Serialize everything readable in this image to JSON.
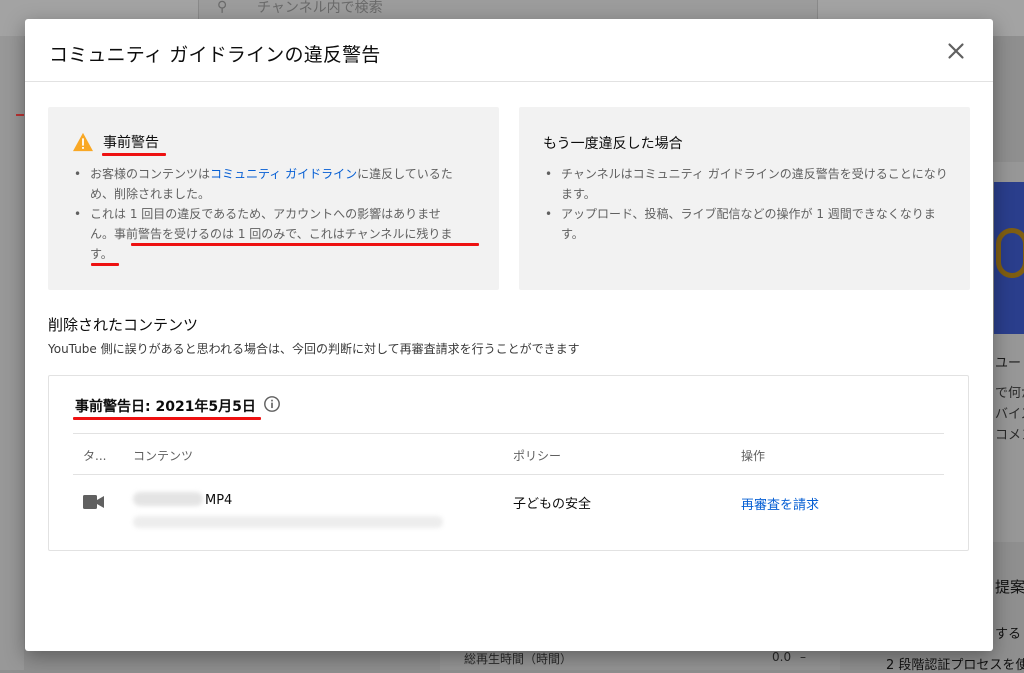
{
  "background": {
    "search_placeholder": "チャンネル内で検索",
    "right_texts": [
      "ユー",
      "で何か",
      "バイス",
      "コメン",
      "提案",
      "する",
      "2 段階認証プロセスを使"
    ],
    "bottom_text": "総再生時間（時間）",
    "bottom_value": "0.0",
    "bottom_dash": "–"
  },
  "dialog": {
    "title": "コミュニティ ガイドラインの違反警告",
    "close_icon": "close-icon"
  },
  "warning_card": {
    "heading": "事前警告",
    "bullet1_pre": "お客様のコンテンツは",
    "bullet1_link": "コミュニティ ガイドライン",
    "bullet1_post": "に違反しているため、削除されました。",
    "bullet2_line1": "これは 1 回目の違反であるため、アカウントへの影響はありませ",
    "bullet2_line2": "ん。事前警告を受けるのは 1 回のみで、これはチャンネルに残りま",
    "bullet2_line3": "す。"
  },
  "repeat_card": {
    "heading": "もう一度違反した場合",
    "bullets": [
      "チャンネルはコミュニティ ガイドラインの違反警告を受けることになります。",
      "アップロード、投稿、ライブ配信などの操作が 1 週間できなくなります。"
    ]
  },
  "removed": {
    "title": "削除されたコンテンツ",
    "subtitle": "YouTube 側に誤りがあると思われる場合は、今回の判断に対して再審査請求を行うことができます",
    "strike_date": "事前警告日: 2021年5月5日",
    "columns": {
      "type": "タ...",
      "content": "コンテンツ",
      "policy": "ポリシー",
      "action": "操作"
    },
    "rows": [
      {
        "file_ext": "MP4",
        "policy": "子どもの安全",
        "action": "再審査を請求"
      }
    ]
  },
  "colors": {
    "accent_link": "#065fd4",
    "warning": "#f9a825",
    "highlight_underline": "#ee1111"
  }
}
